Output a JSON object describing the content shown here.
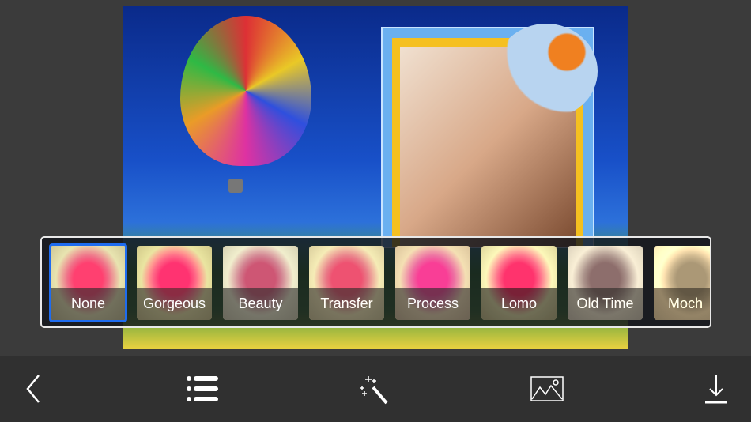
{
  "filters": [
    {
      "label": "None",
      "selected": true
    },
    {
      "label": "Gorgeous",
      "selected": false
    },
    {
      "label": "Beauty",
      "selected": false
    },
    {
      "label": "Transfer",
      "selected": false
    },
    {
      "label": "Process",
      "selected": false
    },
    {
      "label": "Lomo",
      "selected": false
    },
    {
      "label": "Old Time",
      "selected": false
    },
    {
      "label": "Moch",
      "selected": false
    }
  ],
  "toolbar": {
    "icons": [
      "back-chevron-icon",
      "list-icon",
      "magic-wand-icon",
      "image-icon",
      "download-icon"
    ]
  },
  "colors": {
    "selected_border": "#1e6cf0",
    "toolbar_bg": "#303030",
    "background": "#3b3b3b"
  }
}
